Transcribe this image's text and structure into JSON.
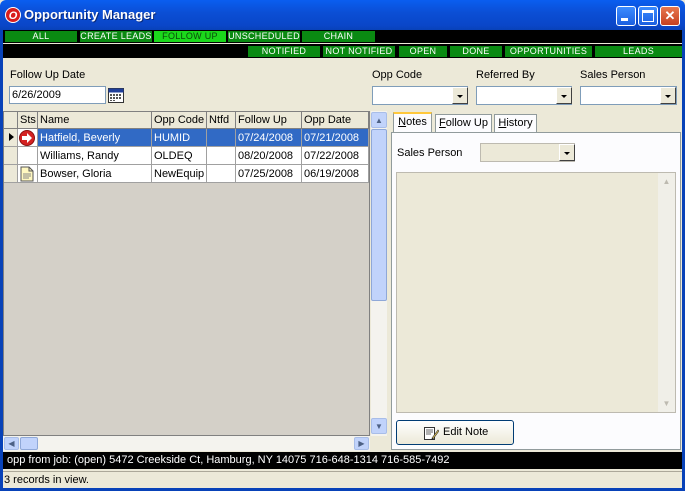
{
  "window": {
    "title": "Opportunity Manager",
    "app_icon_glyph": "O"
  },
  "filters_row1": [
    {
      "label": "ALL",
      "active": false
    },
    {
      "label": "CREATE LEADS",
      "active": false
    },
    {
      "label": "FOLLOW UP",
      "active": true
    },
    {
      "label": "UNSCHEDULED",
      "active": false
    },
    {
      "label": "CHAIN",
      "active": false
    }
  ],
  "filters_row2": [
    {
      "label": "NOTIFIED",
      "active": false
    },
    {
      "label": "NOT NOTIFIED",
      "active": false
    },
    {
      "label": "OPEN",
      "active": false
    },
    {
      "label": "DONE",
      "active": false
    },
    {
      "label": "OPPORTUNITIES",
      "active": false
    },
    {
      "label": "LEADS",
      "active": false
    }
  ],
  "followup": {
    "label": "Follow Up Date",
    "value": "6/26/2009"
  },
  "opp_code": {
    "label": "Opp Code",
    "value": ""
  },
  "referred_by": {
    "label": "Referred By",
    "value": ""
  },
  "sales_person": {
    "label": "Sales Person",
    "value": ""
  },
  "grid": {
    "columns": [
      "Sts",
      "Name",
      "Opp Code",
      "Ntfd",
      "Follow Up",
      "Opp Date"
    ],
    "rows": [
      {
        "status_icon": "red-arrow-icon",
        "name": "Hatfield, Beverly",
        "opp_code": "HUMID",
        "ntfd": "",
        "follow_up": "07/24/2008",
        "opp_date": "07/21/2008",
        "selected": true
      },
      {
        "status_icon": "",
        "name": "Williams, Randy",
        "opp_code": "OLDEQ",
        "ntfd": "",
        "follow_up": "08/20/2008",
        "opp_date": "07/22/2008",
        "selected": false
      },
      {
        "status_icon": "note-icon",
        "name": "Bowser, Gloria",
        "opp_code": "NewEquip",
        "ntfd": "",
        "follow_up": "07/25/2008",
        "opp_date": "06/19/2008",
        "selected": false
      }
    ]
  },
  "tabs": [
    {
      "label": "Notes",
      "underline": "N",
      "rest": "otes",
      "active": true
    },
    {
      "label": "Follow Up",
      "underline": "F",
      "rest": "ollow Up",
      "active": false
    },
    {
      "label": "History",
      "underline": "H",
      "rest": "istory",
      "active": false
    }
  ],
  "notes": {
    "sales_person_label": "Sales Person",
    "sales_person_value": "",
    "note_text": "",
    "edit_button": "Edit Note"
  },
  "info_bar": "opp from job: (open) 5472 Creekside Ct, Hamburg, NY 14075  716-648-1314  716-585-7492",
  "status_bar": "3 records in view.",
  "colors": {
    "title_blue": "#0b4fd6",
    "filter_green": "#0a8a12",
    "filter_active": "#1bd81b",
    "selection": "#316ac5"
  }
}
